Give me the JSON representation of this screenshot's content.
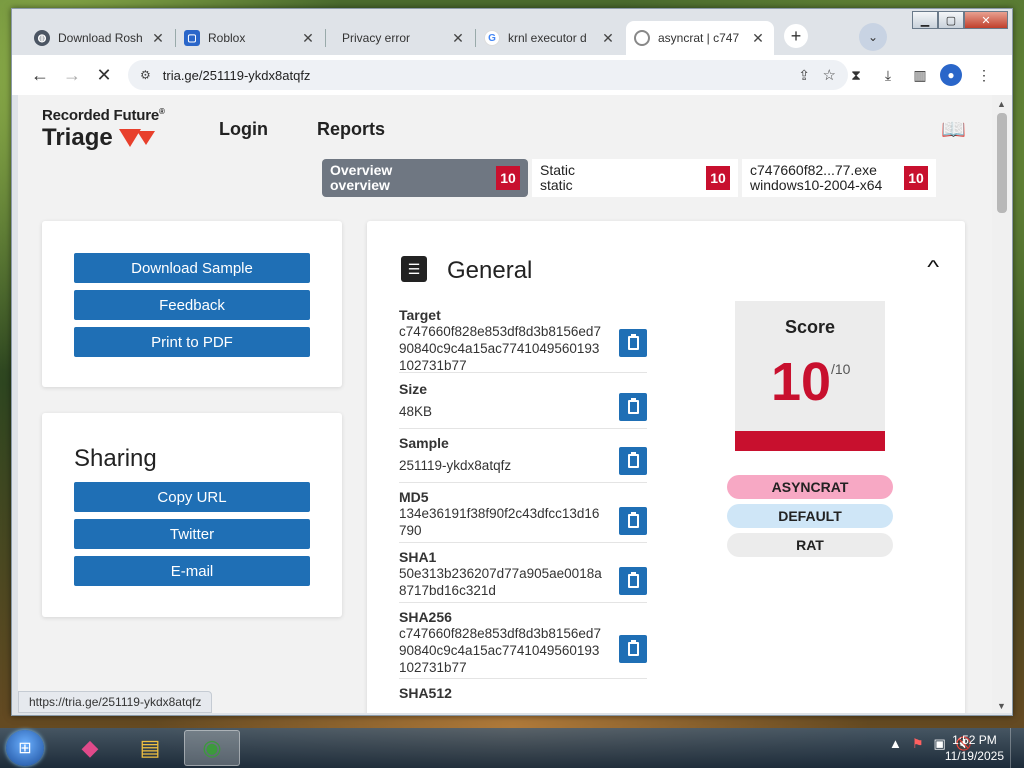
{
  "browser": {
    "tabs": [
      {
        "title": "Download Rosh",
        "favicon": "globe-icon",
        "active": false
      },
      {
        "title": "Roblox",
        "favicon": "roblox-icon",
        "active": false
      },
      {
        "title": "Privacy error",
        "favicon": "",
        "active": false
      },
      {
        "title": "krnl executor d",
        "favicon": "google-icon",
        "active": false
      },
      {
        "title": "asyncrat | c747",
        "favicon": "loading-icon",
        "active": true
      }
    ],
    "url": "tria.ge/251119-ykdx8atqfz",
    "status_url": "https://tria.ge/251119-ykdx8atqfz"
  },
  "site": {
    "brand_top": "Recorded Future",
    "brand_reg": "®",
    "brand_main": "Triage",
    "nav": {
      "login": "Login",
      "reports": "Reports"
    }
  },
  "report_tabs": [
    {
      "line1": "Overview",
      "line2": "overview",
      "score": "10"
    },
    {
      "line1": "Static",
      "line2": "static",
      "score": "10"
    },
    {
      "line1": "c747660f82...77.exe",
      "line2": "windows10-2004-x64",
      "score": "10"
    }
  ],
  "actions": {
    "download": "Download Sample",
    "feedback": "Feedback",
    "print": "Print to PDF"
  },
  "sharing": {
    "title": "Sharing",
    "copy_url": "Copy URL",
    "twitter": "Twitter",
    "email": "E-mail"
  },
  "general": {
    "title": "General",
    "fields": [
      {
        "label": "Target",
        "value": "c747660f828e853df8d3b8156ed790840c9c4a15ac7741049560193102731b77"
      },
      {
        "label": "Size",
        "value": "48KB"
      },
      {
        "label": "Sample",
        "value": "251119-ykdx8atqfz"
      },
      {
        "label": "MD5",
        "value": "134e36191f38f90f2c43dfcc13d16790"
      },
      {
        "label": "SHA1",
        "value": "50e313b236207d77a905ae0018a8717bd16c321d"
      },
      {
        "label": "SHA256",
        "value": "c747660f828e853df8d3b8156ed790840c9c4a15ac7741049560193102731b77"
      },
      {
        "label": "SHA512",
        "value": ""
      }
    ],
    "score": {
      "label": "Score",
      "value": "10",
      "max": "/10"
    },
    "tags": [
      {
        "label": "ASYNCRAT",
        "color": "#f7a8c4"
      },
      {
        "label": "DEFAULT",
        "color": "#cfe6f7"
      },
      {
        "label": "RAT",
        "color": "#ececec"
      }
    ]
  },
  "taskbar": {
    "time": "1:52 PM",
    "date": "11/19/2025"
  }
}
